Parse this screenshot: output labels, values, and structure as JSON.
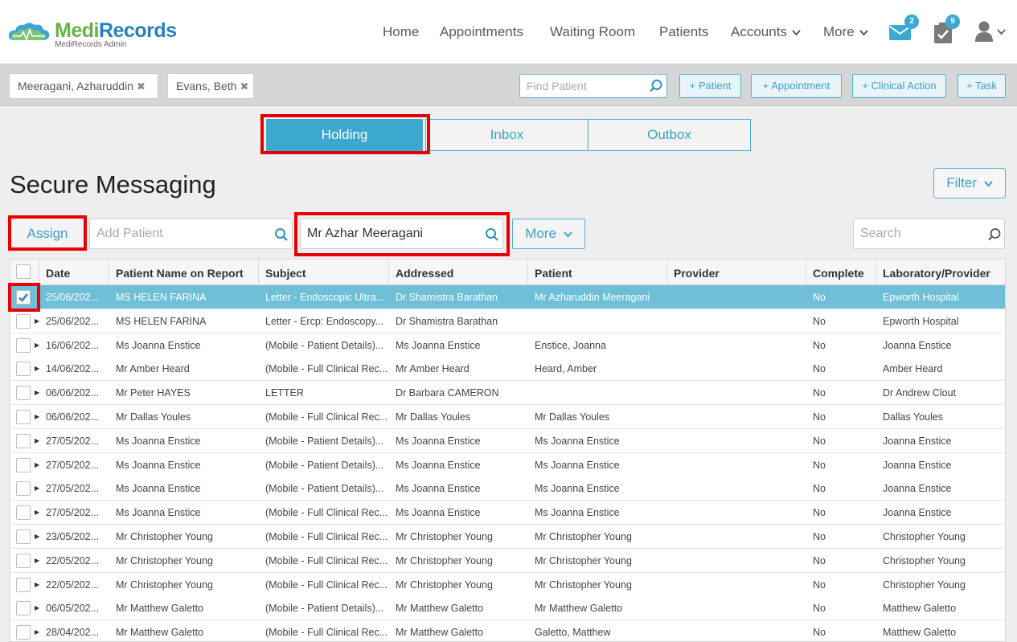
{
  "brand": {
    "name_part1": "Medi",
    "name_part2": "Records",
    "subtitle": "MediRecords Admin",
    "accent": "#3ba9d0",
    "green": "#6ab04c",
    "blue": "#2a7fbd"
  },
  "nav": {
    "items": [
      {
        "label": "Home"
      },
      {
        "label": "Appointments"
      },
      {
        "label": "Waiting Room"
      },
      {
        "label": "Patients"
      },
      {
        "label": "Accounts",
        "dropdown": true
      },
      {
        "label": "More",
        "dropdown": true
      }
    ],
    "messages_badge": "2",
    "tasks_badge": "9"
  },
  "patient_tabs": [
    {
      "label": "Meeragani, Azharuddin",
      "close": "✖"
    },
    {
      "label": "Evans, Beth",
      "close": "✖"
    }
  ],
  "find_patient": {
    "placeholder": "Find Patient"
  },
  "actions": [
    {
      "label": "+ Patient"
    },
    {
      "label": "+ Appointment"
    },
    {
      "label": "+ Clinical Action"
    },
    {
      "label": "+ Task"
    }
  ],
  "segments": [
    {
      "label": "Holding",
      "active": true
    },
    {
      "label": "Inbox",
      "active": false
    },
    {
      "label": "Outbox",
      "active": false
    }
  ],
  "page_title": "Secure Messaging",
  "filter_label": "Filter",
  "toolbar": {
    "assign_label": "Assign",
    "add_patient_placeholder": "Add Patient",
    "patient_value": "Mr Azhar Meeragani",
    "more_label": "More",
    "search_placeholder": "Search"
  },
  "table": {
    "columns": [
      "Date",
      "Patient Name on Report",
      "Subject",
      "Addressed",
      "Patient",
      "Provider",
      "Complete",
      "Laboratory/Provider"
    ],
    "rows": [
      {
        "date": "25/06/202...",
        "name": "MS HELEN FARINA",
        "subject": "Letter - Endoscopic Ultra...",
        "addressed": "Dr Shamistra Barathan",
        "patient": "Mr Azharuddin Meeragani",
        "provider": "",
        "complete": "No",
        "lab": "Epworth Hospital",
        "selected": true
      },
      {
        "date": "25/06/202...",
        "name": "MS HELEN FARINA",
        "subject": "Letter - Ercp: Endoscopy...",
        "addressed": "Dr Shamistra Barathan",
        "patient": "",
        "provider": "",
        "complete": "No",
        "lab": "Epworth Hospital"
      },
      {
        "date": "16/06/202...",
        "name": "Ms Joanna Enstice",
        "subject": "(Mobile - Patient Details)...",
        "addressed": "Ms Joanna Enstice",
        "patient": "Enstice, Joanna",
        "provider": "",
        "complete": "No",
        "lab": "Joanna Enstice"
      },
      {
        "date": "14/06/202...",
        "name": "Mr Amber Heard",
        "subject": "(Mobile - Full Clinical Rec...",
        "addressed": "Mr Amber Heard",
        "patient": "Heard, Amber",
        "provider": "",
        "complete": "No",
        "lab": "Amber Heard"
      },
      {
        "date": "06/06/202...",
        "name": "Mr Peter HAYES",
        "subject": "LETTER",
        "addressed": "Dr Barbara CAMERON",
        "patient": "",
        "provider": "",
        "complete": "No",
        "lab": "Dr Andrew Clout"
      },
      {
        "date": "06/06/202...",
        "name": "Mr Dallas Youles",
        "subject": "(Mobile - Full Clinical Rec...",
        "addressed": "Mr Dallas Youles",
        "patient": "Mr Dallas Youles",
        "provider": "",
        "complete": "No",
        "lab": "Dallas Youles"
      },
      {
        "date": "27/05/202...",
        "name": "Ms Joanna Enstice",
        "subject": "(Mobile - Patient Details)...",
        "addressed": "Ms Joanna Enstice",
        "patient": "Ms Joanna Enstice",
        "provider": "",
        "complete": "No",
        "lab": "Joanna Enstice"
      },
      {
        "date": "27/05/202...",
        "name": "Ms Joanna Enstice",
        "subject": "(Mobile - Patient Details)...",
        "addressed": "Ms Joanna Enstice",
        "patient": "Ms Joanna Enstice",
        "provider": "",
        "complete": "No",
        "lab": "Joanna Enstice"
      },
      {
        "date": "27/05/202...",
        "name": "Ms Joanna Enstice",
        "subject": "(Mobile - Patient Details)...",
        "addressed": "Ms Joanna Enstice",
        "patient": "Ms Joanna Enstice",
        "provider": "",
        "complete": "No",
        "lab": "Joanna Enstice"
      },
      {
        "date": "27/05/202...",
        "name": "Ms Joanna Enstice",
        "subject": "(Mobile - Full Clinical Rec...",
        "addressed": "Ms Joanna Enstice",
        "patient": "Ms Joanna Enstice",
        "provider": "",
        "complete": "No",
        "lab": "Joanna Enstice"
      },
      {
        "date": "23/05/202...",
        "name": "Mr Christopher Young",
        "subject": "(Mobile - Full Clinical Rec...",
        "addressed": "Mr Christopher Young",
        "patient": "Mr Christopher Young",
        "provider": "",
        "complete": "No",
        "lab": "Christopher Young"
      },
      {
        "date": "22/05/202...",
        "name": "Mr Christopher Young",
        "subject": "(Mobile - Full Clinical Rec...",
        "addressed": "Mr Christopher Young",
        "patient": "Mr Christopher Young",
        "provider": "",
        "complete": "No",
        "lab": "Christopher Young"
      },
      {
        "date": "22/05/202...",
        "name": "Mr Christopher Young",
        "subject": "(Mobile - Full Clinical Rec...",
        "addressed": "Mr Christopher Young",
        "patient": "Mr Christopher Young",
        "provider": "",
        "complete": "No",
        "lab": "Christopher Young"
      },
      {
        "date": "06/05/202...",
        "name": "Mr Matthew Galetto",
        "subject": "(Mobile - Patient Details)...",
        "addressed": "Mr Matthew Galetto",
        "patient": "Mr Matthew Galetto",
        "provider": "",
        "complete": "No",
        "lab": "Matthew Galetto"
      },
      {
        "date": "28/04/202...",
        "name": "Mr Matthew Galetto",
        "subject": "(Mobile - Full Clinical Rec...",
        "addressed": "Mr Matthew Galetto",
        "patient": "Galetto, Matthew",
        "provider": "",
        "complete": "No",
        "lab": "Matthew Galetto"
      }
    ]
  }
}
